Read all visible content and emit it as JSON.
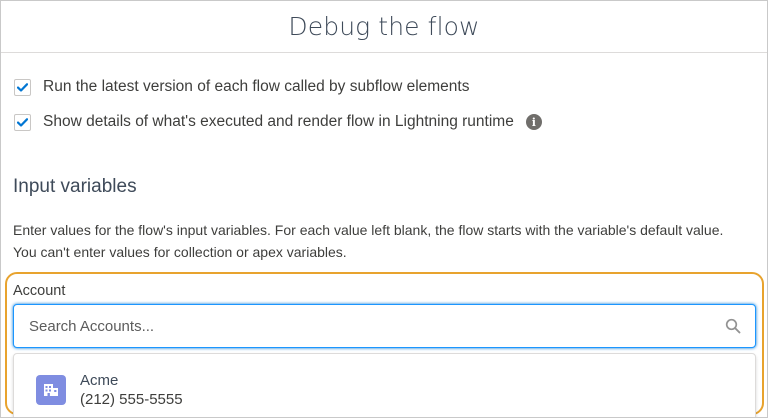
{
  "modal": {
    "title": "Debug the flow"
  },
  "options": [
    {
      "label": "Run the latest version of each flow called by subflow elements",
      "checked": true
    },
    {
      "label": "Show details of what's executed and render flow in Lightning runtime",
      "checked": true
    }
  ],
  "input_variables": {
    "heading": "Input variables",
    "help": "Enter values for the flow's input variables. For each value left blank, the flow starts with the variable's default value. You can't enter values for collection or apex variables."
  },
  "account_lookup": {
    "label": "Account",
    "placeholder": "Search Accounts...",
    "results": [
      {
        "name": "Acme",
        "phone": "(212) 555-5555",
        "icon": "account-icon"
      }
    ]
  },
  "colors": {
    "checkbox_check": "#0176d3",
    "focus_border": "#1b96ff",
    "highlight_outline": "#e8a32e",
    "account_icon_bg": "#7f8de1"
  }
}
